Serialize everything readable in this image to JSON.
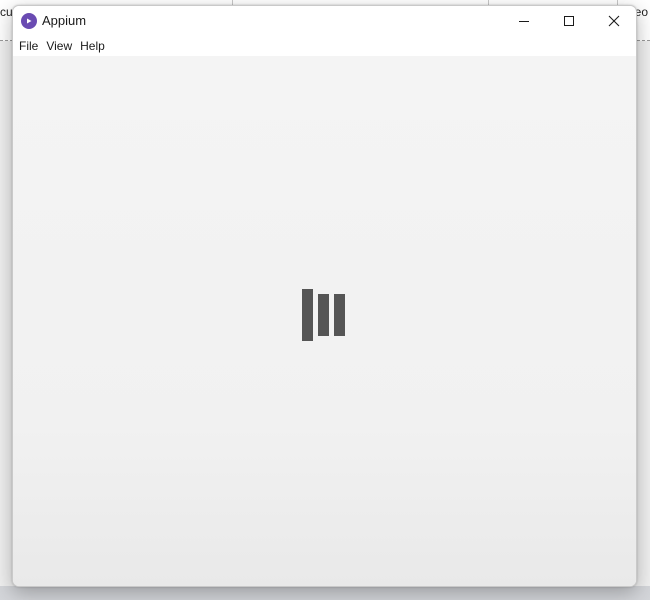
{
  "background_app": {
    "left_text": "cut",
    "right_text": "neo"
  },
  "window": {
    "title": "Appium",
    "logo_icon": "appium-logo-icon",
    "accent_color": "#6a4bb2",
    "controls": {
      "minimize_icon": "minimize-icon",
      "maximize_icon": "maximize-icon",
      "close_icon": "close-icon"
    }
  },
  "menu": {
    "items": [
      {
        "label": "File"
      },
      {
        "label": "View"
      },
      {
        "label": "Help"
      }
    ]
  },
  "content": {
    "loading_icon": "loading-bars-icon"
  }
}
